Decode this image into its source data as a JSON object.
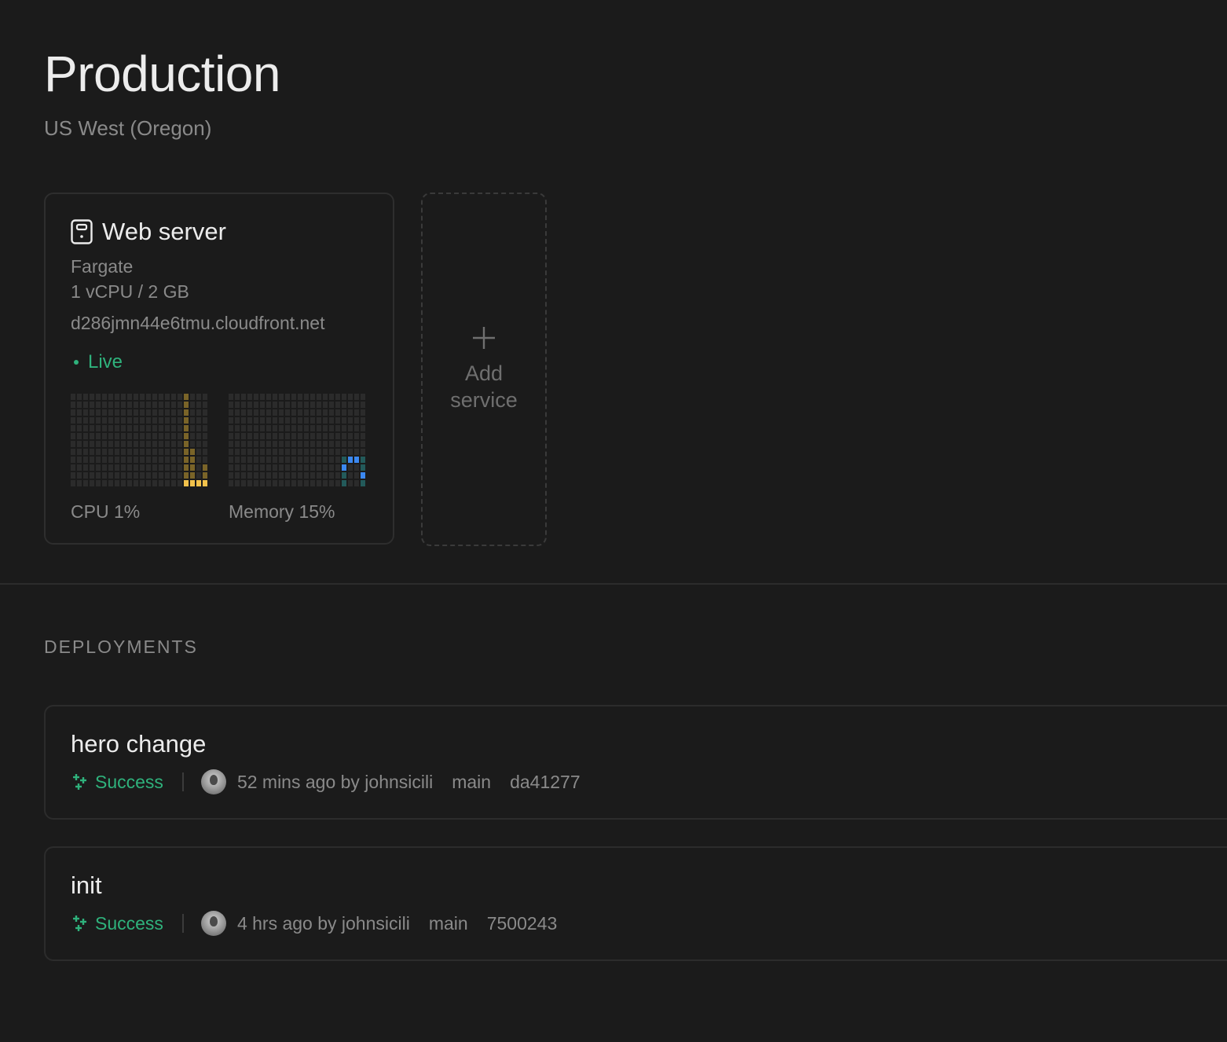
{
  "header": {
    "title": "Production",
    "region": "US West (Oregon)"
  },
  "service": {
    "icon": "server-icon",
    "name": "Web server",
    "platform": "Fargate",
    "size": "1 vCPU / 2 GB",
    "url": "d286jmn44e6tmu.cloudfront.net",
    "status": "Live",
    "status_color": "#2fb27c",
    "metrics": {
      "cpu": {
        "label": "CPU 1%",
        "percent": 1,
        "color_bright": "#f2c14b",
        "color_dim": "#7a6428",
        "grid_columns": 22,
        "grid_rows": 12,
        "history_levels": [
          0,
          0,
          0,
          0,
          0,
          0,
          0,
          0,
          0,
          0,
          0,
          0,
          0,
          0,
          0,
          0,
          0,
          0,
          12,
          5,
          1,
          3
        ]
      },
      "memory": {
        "label": "Memory 15%",
        "percent": 15,
        "color_blue": "#3b88f0",
        "color_teal": "#235a5a",
        "grid_columns": 22,
        "grid_rows": 12,
        "history_levels": [
          0,
          0,
          0,
          0,
          0,
          0,
          0,
          0,
          0,
          0,
          0,
          0,
          0,
          0,
          0,
          0,
          0,
          0,
          3,
          4,
          4,
          2
        ]
      }
    }
  },
  "add_service": {
    "icon": "plus-icon",
    "label": "Add service"
  },
  "deployments": {
    "section_title": "DEPLOYMENTS",
    "items": [
      {
        "title": "hero change",
        "status": "Success",
        "time_author": "52 mins ago by johnsicili",
        "branch": "main",
        "commit": "da41277"
      },
      {
        "title": "init",
        "status": "Success",
        "time_author": "4 hrs ago by johnsicili",
        "branch": "main",
        "commit": "7500243"
      }
    ]
  },
  "colors": {
    "background": "#1b1b1b",
    "success": "#2fb27c",
    "muted_text": "#8a8a8a"
  }
}
